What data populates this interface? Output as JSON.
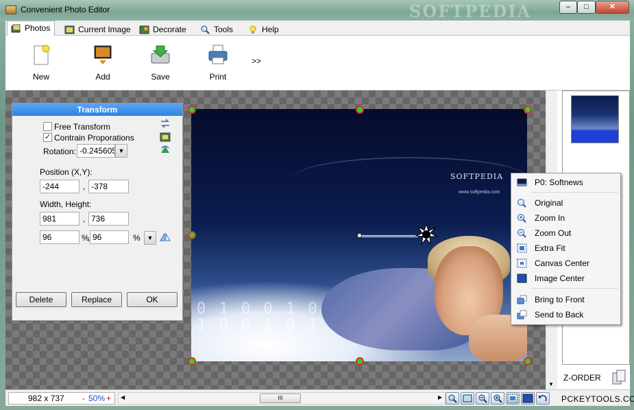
{
  "window": {
    "title": "Convenient Photo Editor",
    "watermark": "SOFTPEDIA",
    "minimize": "–",
    "maximize": "□",
    "close": "✕"
  },
  "tabs": [
    {
      "label": "Photos",
      "icon": "photos-icon",
      "active": true
    },
    {
      "label": "Current Image",
      "icon": "image-icon"
    },
    {
      "label": "Decorate",
      "icon": "decorate-icon"
    },
    {
      "label": "Tools",
      "icon": "magnifier-icon"
    },
    {
      "label": "Help",
      "icon": "lightbulb-icon"
    }
  ],
  "ribbon": {
    "new": "New",
    "add": "Add",
    "save": "Save",
    "print": "Print",
    "more": ">>"
  },
  "transform": {
    "title": "Transform",
    "free_transform": "Free Transform",
    "free_transform_checked": false,
    "contrain_proporations": "Contrain Proporations",
    "contrain_checked": true,
    "rotation_label": "Rotation:",
    "rotation_value": "-0.2456050",
    "position_label": "Position  (X,Y):",
    "pos_x": "-244",
    "pos_y": "-378",
    "size_label": "Width, Height:",
    "width": "981",
    "height": "736",
    "width_pct": "96",
    "height_pct": "96",
    "comma": ",",
    "pct_sign": "%",
    "delete": "Delete",
    "replace": "Replace",
    "ok": "OK"
  },
  "image": {
    "brand": "SOFTPEDIA",
    "brand_url": "www.softpedia.com"
  },
  "context_menu": {
    "layer": "P0: Softnews",
    "original": "Original",
    "zoom_in": "Zoom In",
    "zoom_out": "Zoom Out",
    "extra_fit": "Extra Fit",
    "canvas_center": "Canvas Center",
    "image_center": "Image Center",
    "bring_to_front": "Bring to Front",
    "send_to_back": "Send to Back"
  },
  "sidepane": {
    "zorder": "Z-ORDER"
  },
  "status": {
    "dimensions": "982 x 737",
    "zoom_minus": "-",
    "zoom": "50%",
    "zoom_plus": "+",
    "brand": "PCKEYTOOLS.COM",
    "scroll_grip": "III"
  }
}
